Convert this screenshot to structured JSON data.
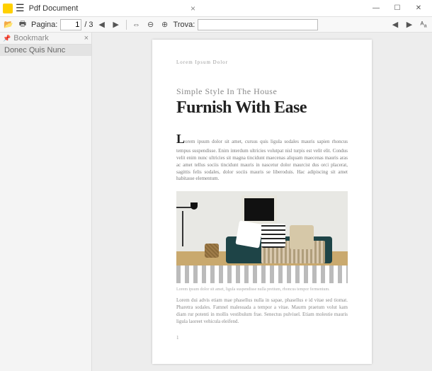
{
  "titlebar": {
    "title": "Pdf Document"
  },
  "toolbar": {
    "pagina_label": "Pagina:",
    "page_current": "1",
    "page_total": "/ 3",
    "trova_label": "Trova:"
  },
  "sidebar": {
    "header": "Bookmark",
    "bookmarks": [
      "Donec Quis Nunc"
    ]
  },
  "document": {
    "eyebrow": "Lorem Ipsum Dolor",
    "subhead": "Simple Style In The House",
    "headline": "Furnish With Ease",
    "dropcap": "L",
    "body1": "orem ipsum dolor sit amet, cursus quis ligula sodales mauris sapien rhoncus tempus suspendisse. Enim interdum ultricies volutpat nisl turpis est velit elit. Condus velit enim nunc ultricies sit magna tincidunt maecenas aliquam maecenas mauris aras ac amet tellus sociis tincidunt mauris in nascetur dolor maurcist dus orci placerat, sagittis felis sodales, dolor sociis mauris se liberoduis. Hac adipiscing sit amet habitasse elementum.",
    "caption": "Lorem ipsum dolor sit amet, ligula suspendisse nulla pretium, rhoncus tempor fermentum.",
    "body2": "Lorem dui advis etiam mae phasellus nulla in sapae, phasellus e id vitae sed tiomat. Pharetra sodales. Famnel malesuada a tempor a vitae. Maurm praetum volut kam diam rur potenti in mollis vestibulum frae. Senectus pulviuel. Etiam molestie mauris ligula laoreet vehicula eleifend.",
    "page_number": "1"
  }
}
